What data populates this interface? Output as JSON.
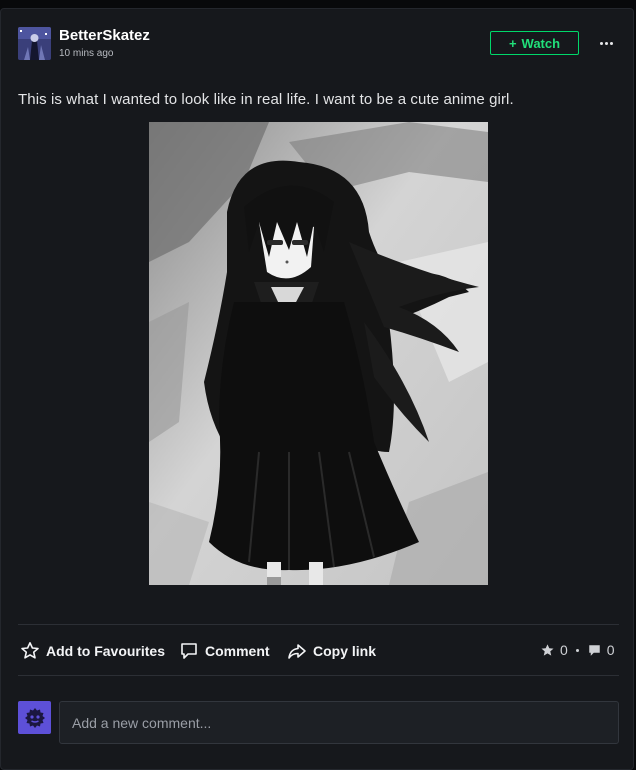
{
  "post": {
    "author": "BetterSkatez",
    "timestamp": "10 mins ago",
    "text": "This is what I wanted to look like in real life. I want to be a cute anime girl.",
    "watch_label": "Watch",
    "watch_icon": "plus-icon"
  },
  "actions": {
    "favourite_label": "Add to Favourites",
    "comment_label": "Comment",
    "copy_link_label": "Copy link"
  },
  "stats": {
    "favourites": "0",
    "comments": "0"
  },
  "comment_box": {
    "placeholder": "Add a new comment..."
  },
  "colors": {
    "accent_green": "#00d86a",
    "self_avatar_bg": "#5d50d8",
    "card_bg": "#16181c"
  }
}
